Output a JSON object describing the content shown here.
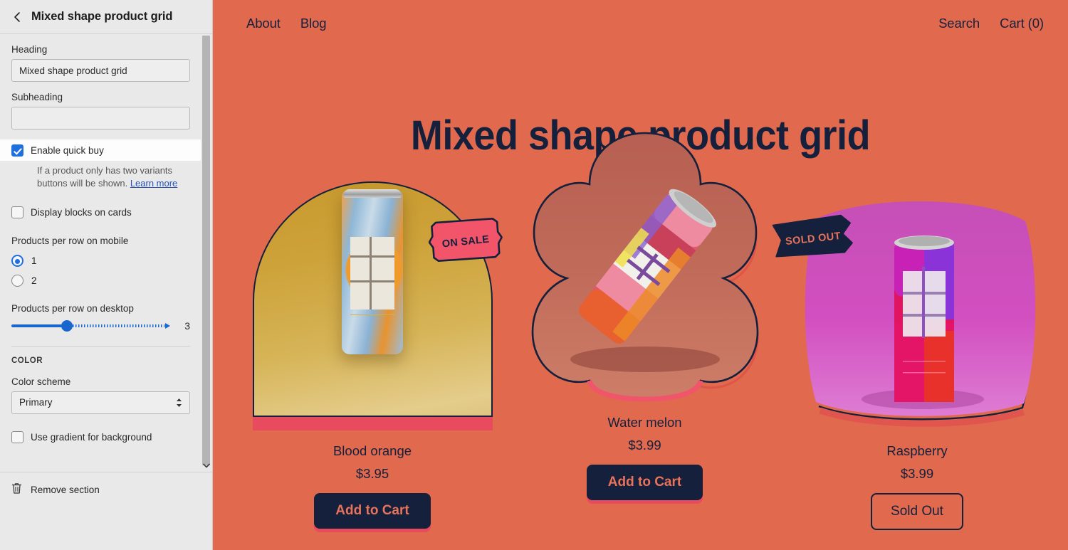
{
  "sidebar": {
    "back_icon": "chevron-left-icon",
    "title": "Mixed shape product grid",
    "heading_label": "Heading",
    "heading_value": "Mixed shape product grid",
    "subheading_label": "Subheading",
    "subheading_value": "",
    "subheading_placeholder": "",
    "quick_buy_label": "Enable quick buy",
    "quick_buy_checked": true,
    "quick_buy_help": "If a product only has two variants buttons will be shown.",
    "quick_buy_help_link": "Learn more",
    "display_blocks_label": "Display blocks on cards",
    "display_blocks_checked": false,
    "mobile_group_label": "Products per row on mobile",
    "mobile_options": [
      "1",
      "2"
    ],
    "mobile_selected": "1",
    "desktop_group_label": "Products per row on desktop",
    "desktop_value": "3",
    "desktop_min": "1",
    "desktop_max": "6",
    "color_section_label": "COLOR",
    "color_scheme_label": "Color scheme",
    "color_scheme_value": "Primary",
    "gradient_label": "Use gradient for background",
    "gradient_checked": false,
    "remove_icon": "trash-icon",
    "remove_label": "Remove section",
    "scrollbar_down_icon": "chevron-down-icon"
  },
  "preview": {
    "background_color": "#e0694e",
    "ink_color": "#14203c",
    "accent_color": "#e94b5e",
    "nav": {
      "left_links": [
        "About",
        "Blog"
      ],
      "right_links": [
        "Search",
        "Cart (0)"
      ]
    },
    "hero_title": "Mixed shape product grid",
    "products": [
      {
        "shape": "arch",
        "name": "Blood orange",
        "price": "$3.95",
        "button_label": "Add to Cart",
        "button_style": "solid",
        "badge": "ON SALE",
        "badge_style": "ticket",
        "bg_color": "#cda239"
      },
      {
        "shape": "clover",
        "name": "Water melon",
        "price": "$3.99",
        "button_label": "Add to Cart",
        "button_style": "solid",
        "badge": "",
        "badge_style": "",
        "bg_color": "#c06a59"
      },
      {
        "shape": "squircle",
        "name": "Raspberry",
        "price": "$3.99",
        "button_label": "Sold Out",
        "button_style": "outline",
        "badge": "SOLD OUT",
        "badge_style": "ribbon",
        "bg_color": "#cc4dbb"
      }
    ]
  }
}
